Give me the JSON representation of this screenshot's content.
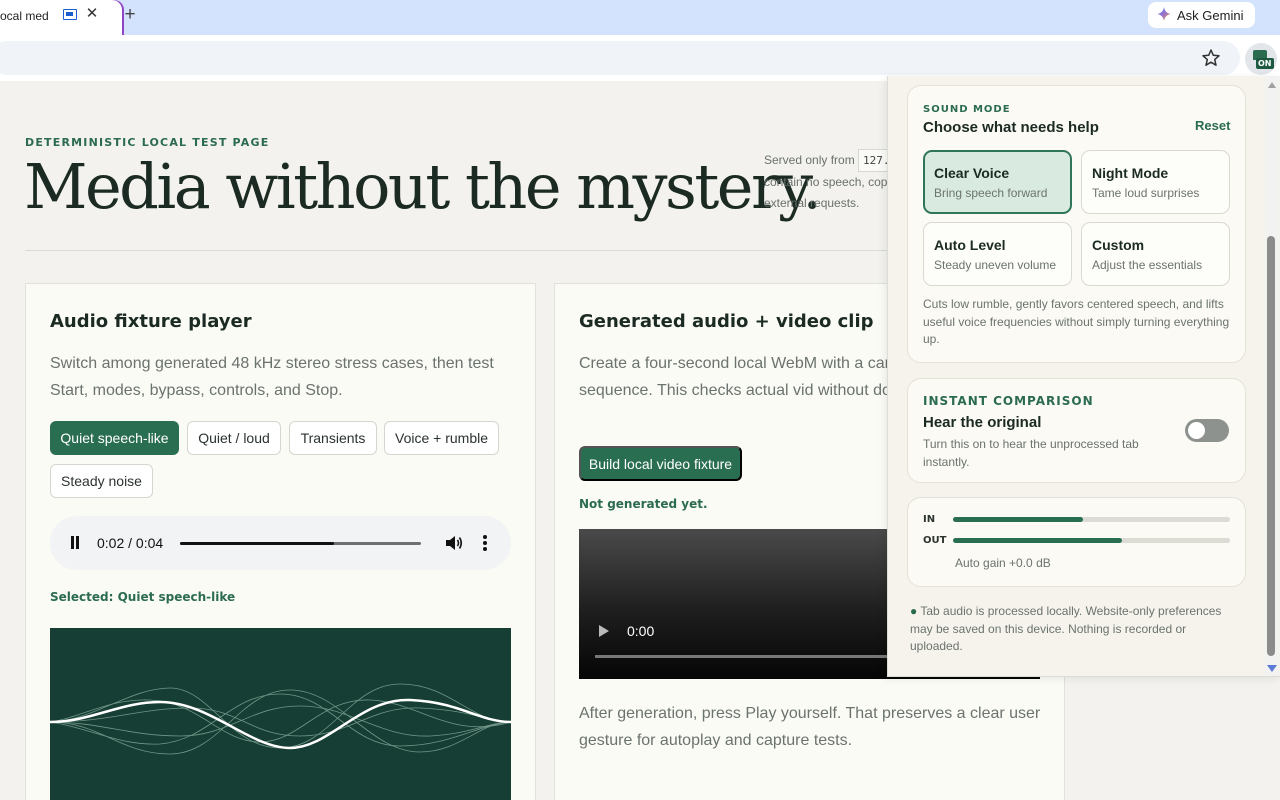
{
  "browser": {
    "tab_title": "ocal media",
    "tab_close": "✕",
    "new_tab": "+",
    "ask_gemini": "Ask Gemini",
    "extension_badge": "ON"
  },
  "page": {
    "eyebrow": "DETERMINISTIC LOCAL TEST PAGE",
    "hero": "Media without the mystery.",
    "served_line1_prefix": "Served only from",
    "served_chip": "127.",
    "served_line2": "contain no speech, cop",
    "served_line3": "external requests."
  },
  "audio_card": {
    "title": "Audio fixture player",
    "description": "Switch among generated 48 kHz stereo stress cases, then test Start, modes, bypass, controls, and Stop.",
    "chips": [
      "Quiet speech-like",
      "Quiet / loud",
      "Transients",
      "Voice + rumble",
      "Steady noise"
    ],
    "active_chip": "Quiet speech-like",
    "time": "0:02 / 0:04",
    "progress": 0.64,
    "selected": "Selected: Quiet speech-like"
  },
  "video_card": {
    "title": "Generated audio + video clip",
    "description": "Create a four-second local WebM with a car simple tone sequence. This checks actual vid without downloading media.",
    "build_button": "Build local video fixture",
    "status": "Not generated yet.",
    "video_time": "0:00",
    "after": "After generation, press Play yourself. That preserves a clear user gesture for autoplay and capture tests."
  },
  "popup": {
    "sound_mode": {
      "eyebrow": "SOUND MODE",
      "title": "Choose what needs help",
      "reset": "Reset",
      "modes": [
        {
          "name": "Clear Voice",
          "sub": "Bring speech forward",
          "active": true
        },
        {
          "name": "Night Mode",
          "sub": "Tame loud surprises",
          "active": false
        },
        {
          "name": "Auto Level",
          "sub": "Steady uneven volume",
          "active": false
        },
        {
          "name": "Custom",
          "sub": "Adjust the essentials",
          "active": false
        }
      ],
      "description": "Cuts low rumble, gently favors centered speech, and lifts useful voice frequencies without simply turning everything up."
    },
    "comparison": {
      "eyebrow": "INSTANT COMPARISON",
      "title": "Hear the original",
      "description": "Turn this on to hear the unprocessed tab instantly.",
      "toggle_on": false
    },
    "meters": {
      "in_label": "IN",
      "in_level": 0.47,
      "out_label": "OUT",
      "out_level": 0.61,
      "gain": "Auto gain +0.0 dB"
    },
    "privacy_bullet": "●",
    "privacy": "Tab audio is processed locally. Website-only preferences may be saved on this device. Nothing is recorded or uploaded."
  },
  "colors": {
    "accent": "#2a6e52",
    "waveform_bg": "#173e34",
    "tab_strip": "#d3e3fd"
  }
}
